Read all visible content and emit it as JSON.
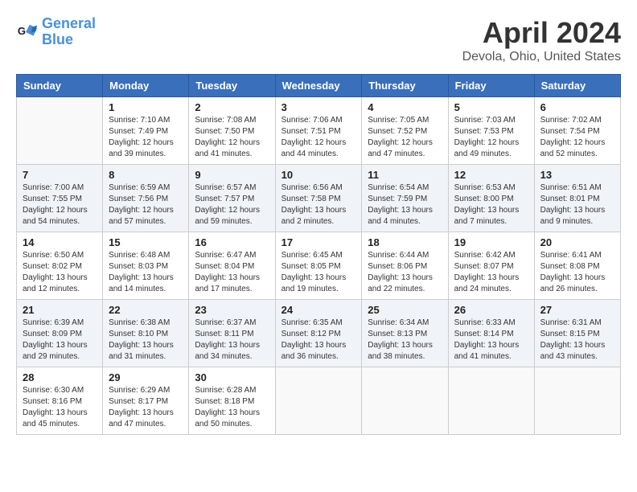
{
  "header": {
    "logo_line1": "General",
    "logo_line2": "Blue",
    "month": "April 2024",
    "location": "Devola, Ohio, United States"
  },
  "days_of_week": [
    "Sunday",
    "Monday",
    "Tuesday",
    "Wednesday",
    "Thursday",
    "Friday",
    "Saturday"
  ],
  "weeks": [
    [
      {
        "day": "",
        "empty": true
      },
      {
        "day": "1",
        "sunrise": "Sunrise: 7:10 AM",
        "sunset": "Sunset: 7:49 PM",
        "daylight": "Daylight: 12 hours and 39 minutes."
      },
      {
        "day": "2",
        "sunrise": "Sunrise: 7:08 AM",
        "sunset": "Sunset: 7:50 PM",
        "daylight": "Daylight: 12 hours and 41 minutes."
      },
      {
        "day": "3",
        "sunrise": "Sunrise: 7:06 AM",
        "sunset": "Sunset: 7:51 PM",
        "daylight": "Daylight: 12 hours and 44 minutes."
      },
      {
        "day": "4",
        "sunrise": "Sunrise: 7:05 AM",
        "sunset": "Sunset: 7:52 PM",
        "daylight": "Daylight: 12 hours and 47 minutes."
      },
      {
        "day": "5",
        "sunrise": "Sunrise: 7:03 AM",
        "sunset": "Sunset: 7:53 PM",
        "daylight": "Daylight: 12 hours and 49 minutes."
      },
      {
        "day": "6",
        "sunrise": "Sunrise: 7:02 AM",
        "sunset": "Sunset: 7:54 PM",
        "daylight": "Daylight: 12 hours and 52 minutes."
      }
    ],
    [
      {
        "day": "7",
        "sunrise": "Sunrise: 7:00 AM",
        "sunset": "Sunset: 7:55 PM",
        "daylight": "Daylight: 12 hours and 54 minutes."
      },
      {
        "day": "8",
        "sunrise": "Sunrise: 6:59 AM",
        "sunset": "Sunset: 7:56 PM",
        "daylight": "Daylight: 12 hours and 57 minutes."
      },
      {
        "day": "9",
        "sunrise": "Sunrise: 6:57 AM",
        "sunset": "Sunset: 7:57 PM",
        "daylight": "Daylight: 12 hours and 59 minutes."
      },
      {
        "day": "10",
        "sunrise": "Sunrise: 6:56 AM",
        "sunset": "Sunset: 7:58 PM",
        "daylight": "Daylight: 13 hours and 2 minutes."
      },
      {
        "day": "11",
        "sunrise": "Sunrise: 6:54 AM",
        "sunset": "Sunset: 7:59 PM",
        "daylight": "Daylight: 13 hours and 4 minutes."
      },
      {
        "day": "12",
        "sunrise": "Sunrise: 6:53 AM",
        "sunset": "Sunset: 8:00 PM",
        "daylight": "Daylight: 13 hours and 7 minutes."
      },
      {
        "day": "13",
        "sunrise": "Sunrise: 6:51 AM",
        "sunset": "Sunset: 8:01 PM",
        "daylight": "Daylight: 13 hours and 9 minutes."
      }
    ],
    [
      {
        "day": "14",
        "sunrise": "Sunrise: 6:50 AM",
        "sunset": "Sunset: 8:02 PM",
        "daylight": "Daylight: 13 hours and 12 minutes."
      },
      {
        "day": "15",
        "sunrise": "Sunrise: 6:48 AM",
        "sunset": "Sunset: 8:03 PM",
        "daylight": "Daylight: 13 hours and 14 minutes."
      },
      {
        "day": "16",
        "sunrise": "Sunrise: 6:47 AM",
        "sunset": "Sunset: 8:04 PM",
        "daylight": "Daylight: 13 hours and 17 minutes."
      },
      {
        "day": "17",
        "sunrise": "Sunrise: 6:45 AM",
        "sunset": "Sunset: 8:05 PM",
        "daylight": "Daylight: 13 hours and 19 minutes."
      },
      {
        "day": "18",
        "sunrise": "Sunrise: 6:44 AM",
        "sunset": "Sunset: 8:06 PM",
        "daylight": "Daylight: 13 hours and 22 minutes."
      },
      {
        "day": "19",
        "sunrise": "Sunrise: 6:42 AM",
        "sunset": "Sunset: 8:07 PM",
        "daylight": "Daylight: 13 hours and 24 minutes."
      },
      {
        "day": "20",
        "sunrise": "Sunrise: 6:41 AM",
        "sunset": "Sunset: 8:08 PM",
        "daylight": "Daylight: 13 hours and 26 minutes."
      }
    ],
    [
      {
        "day": "21",
        "sunrise": "Sunrise: 6:39 AM",
        "sunset": "Sunset: 8:09 PM",
        "daylight": "Daylight: 13 hours and 29 minutes."
      },
      {
        "day": "22",
        "sunrise": "Sunrise: 6:38 AM",
        "sunset": "Sunset: 8:10 PM",
        "daylight": "Daylight: 13 hours and 31 minutes."
      },
      {
        "day": "23",
        "sunrise": "Sunrise: 6:37 AM",
        "sunset": "Sunset: 8:11 PM",
        "daylight": "Daylight: 13 hours and 34 minutes."
      },
      {
        "day": "24",
        "sunrise": "Sunrise: 6:35 AM",
        "sunset": "Sunset: 8:12 PM",
        "daylight": "Daylight: 13 hours and 36 minutes."
      },
      {
        "day": "25",
        "sunrise": "Sunrise: 6:34 AM",
        "sunset": "Sunset: 8:13 PM",
        "daylight": "Daylight: 13 hours and 38 minutes."
      },
      {
        "day": "26",
        "sunrise": "Sunrise: 6:33 AM",
        "sunset": "Sunset: 8:14 PM",
        "daylight": "Daylight: 13 hours and 41 minutes."
      },
      {
        "day": "27",
        "sunrise": "Sunrise: 6:31 AM",
        "sunset": "Sunset: 8:15 PM",
        "daylight": "Daylight: 13 hours and 43 minutes."
      }
    ],
    [
      {
        "day": "28",
        "sunrise": "Sunrise: 6:30 AM",
        "sunset": "Sunset: 8:16 PM",
        "daylight": "Daylight: 13 hours and 45 minutes."
      },
      {
        "day": "29",
        "sunrise": "Sunrise: 6:29 AM",
        "sunset": "Sunset: 8:17 PM",
        "daylight": "Daylight: 13 hours and 47 minutes."
      },
      {
        "day": "30",
        "sunrise": "Sunrise: 6:28 AM",
        "sunset": "Sunset: 8:18 PM",
        "daylight": "Daylight: 13 hours and 50 minutes."
      },
      {
        "day": "",
        "empty": true
      },
      {
        "day": "",
        "empty": true
      },
      {
        "day": "",
        "empty": true
      },
      {
        "day": "",
        "empty": true
      }
    ]
  ]
}
